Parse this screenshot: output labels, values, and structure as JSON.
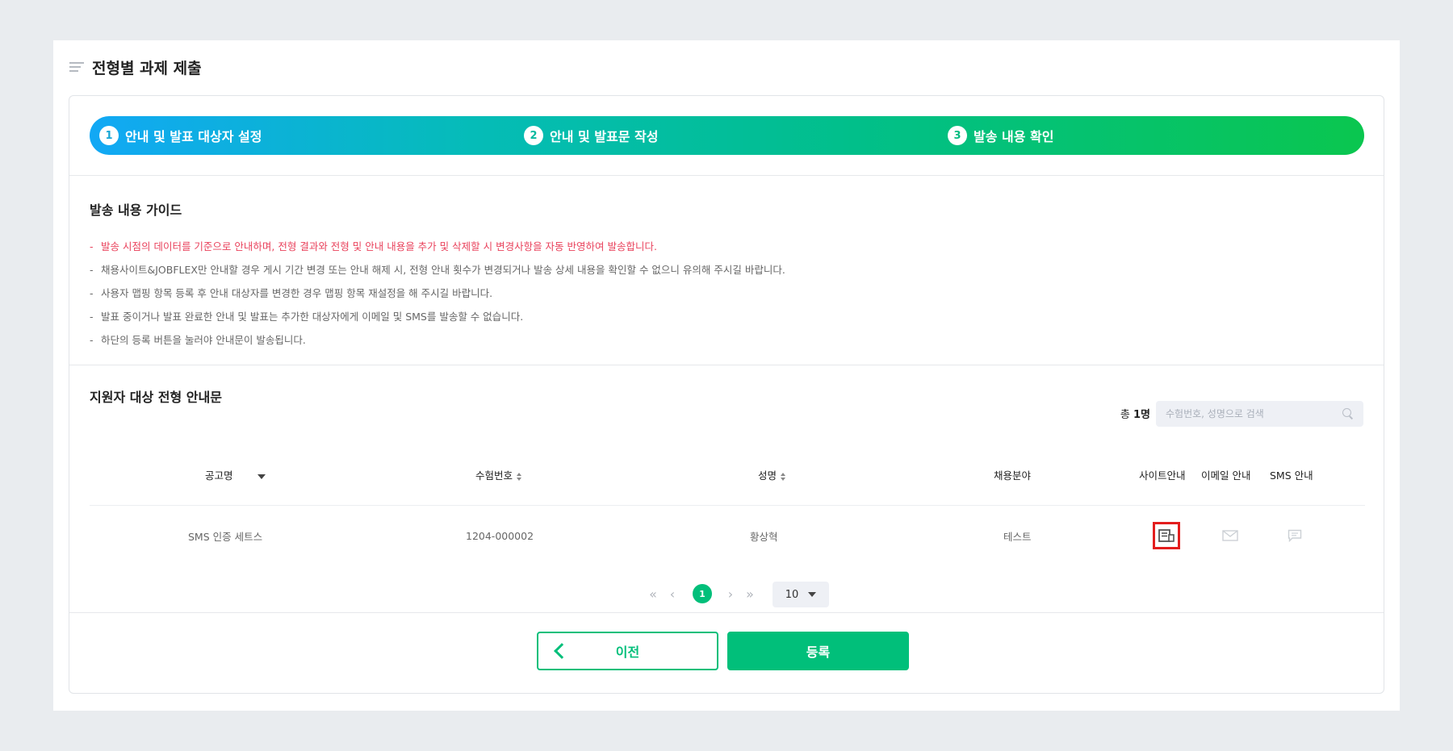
{
  "page": {
    "title": "전형별 과제 제출"
  },
  "stepper": {
    "steps": [
      {
        "num": "1",
        "label": "안내 및 발표 대상자 설정"
      },
      {
        "num": "2",
        "label": "안내 및 발표문 작성"
      },
      {
        "num": "3",
        "label": "발송 내용 확인"
      }
    ]
  },
  "guide": {
    "title": "발송 내용 가이드",
    "items": [
      "발송 시점의 데이터를 기준으로 안내하며, 전형 결과와 전형 및 안내 내용을 추가 및 삭제할 시 변경사항을 자동 반영하여 발송합니다.",
      "채용사이트&JOBFLEX만 안내할 경우 게시 기간 변경 또는 안내 해제 시, 전형 안내 횟수가 변경되거나 발송 상세 내용을 확인할 수 없으니 유의해 주시길 바랍니다.",
      "사용자 맵핑 항목 등록 후 안내 대상자를 변경한 경우 맵핑 항목 재설정을 해 주시길 바랍니다.",
      "발표 중이거나 발표 완료한 안내 및 발표는 추가한 대상자에게 이메일 및 SMS를 발송할 수 없습니다.",
      "하단의 등록 버튼을 눌러야 안내문이 발송됩니다."
    ]
  },
  "list": {
    "title": "지원자 대상 전형 안내문",
    "total_prefix": "총",
    "total_count": "1명",
    "search_placeholder": "수험번호, 성명으로 검색",
    "columns": {
      "posting": "공고명",
      "exam_no": "수험번호",
      "name": "성명",
      "field": "채용분야",
      "site": "사이트안내",
      "email": "이메일 안내",
      "sms": "SMS 안내"
    },
    "rows": [
      {
        "posting": "SMS 인증 세트스",
        "exam_no": "1204-000002",
        "name": "황상혁",
        "field": "테스트"
      }
    ]
  },
  "pagination": {
    "current": "1",
    "page_size": "10"
  },
  "buttons": {
    "prev": "이전",
    "register": "등록"
  },
  "colors": {
    "primary": "#01bf7a",
    "alert": "#e9425c",
    "highlight": "#e31d1d"
  }
}
